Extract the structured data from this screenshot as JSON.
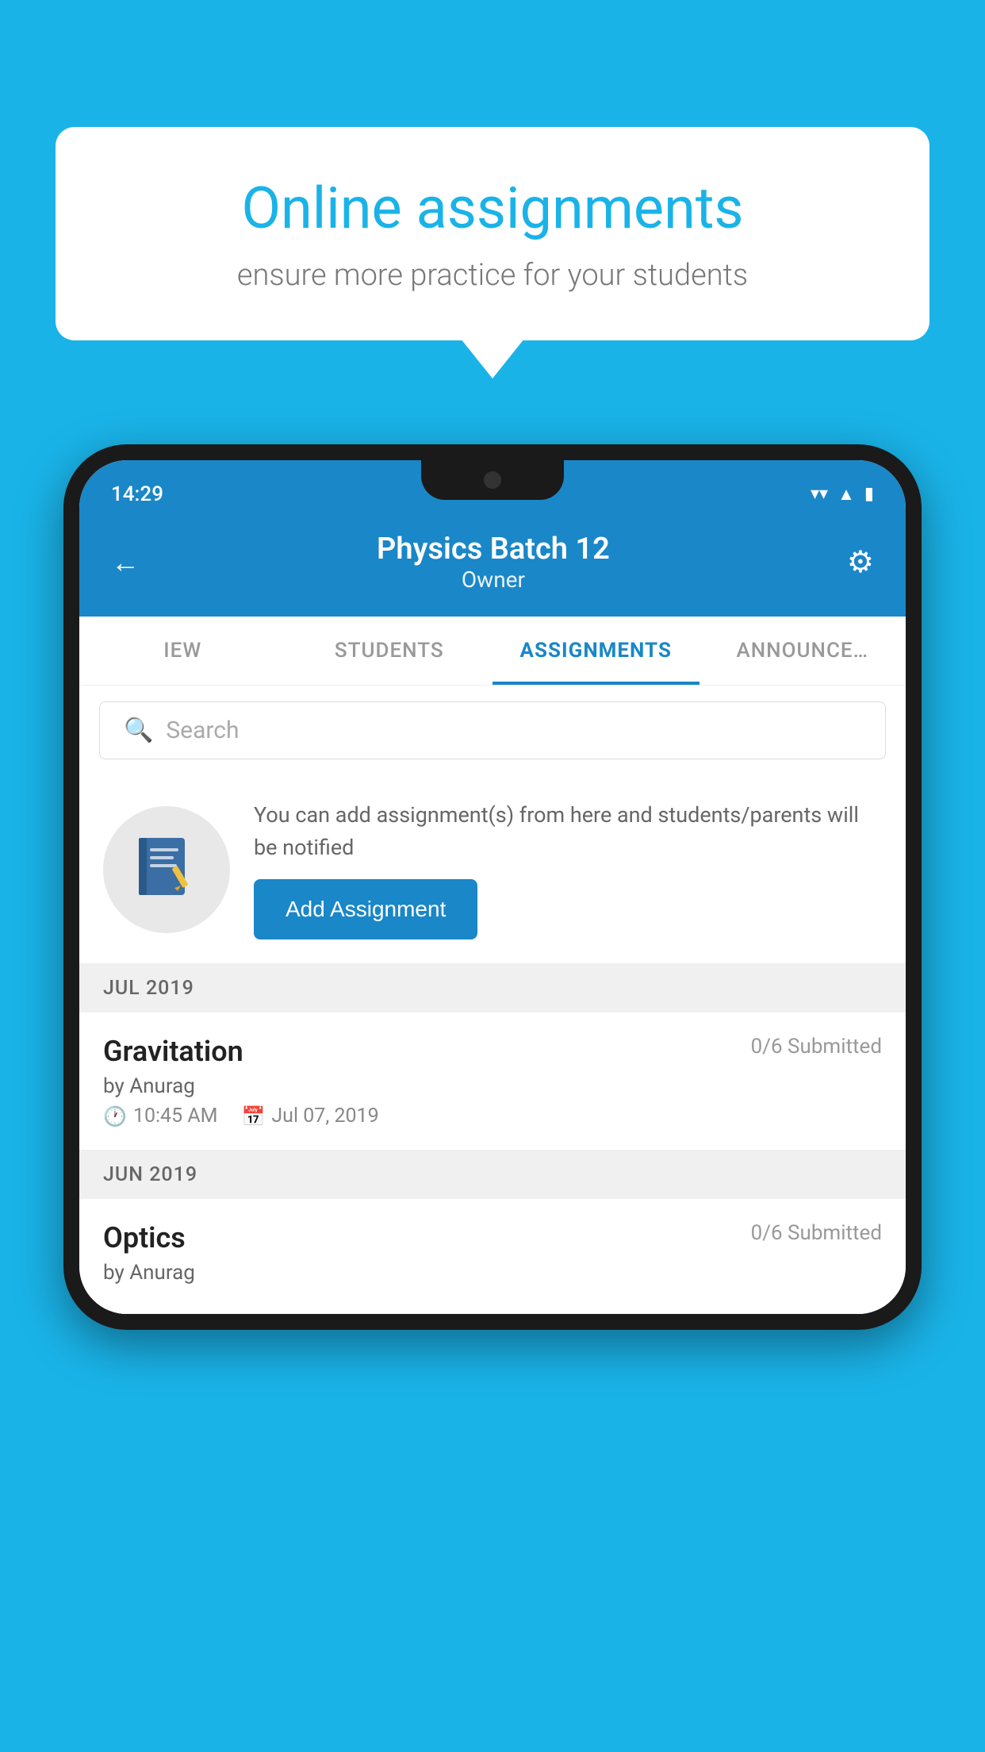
{
  "background": {
    "color": "#1AB3E8"
  },
  "speech_bubble": {
    "title": "Online assignments",
    "subtitle": "ensure more practice for your students"
  },
  "status_bar": {
    "time": "14:29",
    "wifi": "▼",
    "signal": "▲",
    "battery": "▮"
  },
  "app_header": {
    "title": "Physics Batch 12",
    "subtitle": "Owner",
    "back_label": "←",
    "settings_label": "⚙"
  },
  "tabs": [
    {
      "label": "IEW",
      "active": false
    },
    {
      "label": "STUDENTS",
      "active": false
    },
    {
      "label": "ASSIGNMENTS",
      "active": true
    },
    {
      "label": "ANNOUNCE…",
      "active": false
    }
  ],
  "search": {
    "placeholder": "Search"
  },
  "promo": {
    "text": "You can add assignment(s) from here and students/parents will be notified",
    "button_label": "Add Assignment"
  },
  "sections": [
    {
      "month": "JUL 2019",
      "assignments": [
        {
          "title": "Gravitation",
          "submitted": "0/6 Submitted",
          "author": "by Anurag",
          "time": "10:45 AM",
          "date": "Jul 07, 2019"
        }
      ]
    },
    {
      "month": "JUN 2019",
      "assignments": [
        {
          "title": "Optics",
          "submitted": "0/6 Submitted",
          "author": "by Anurag",
          "time": "",
          "date": ""
        }
      ]
    }
  ]
}
